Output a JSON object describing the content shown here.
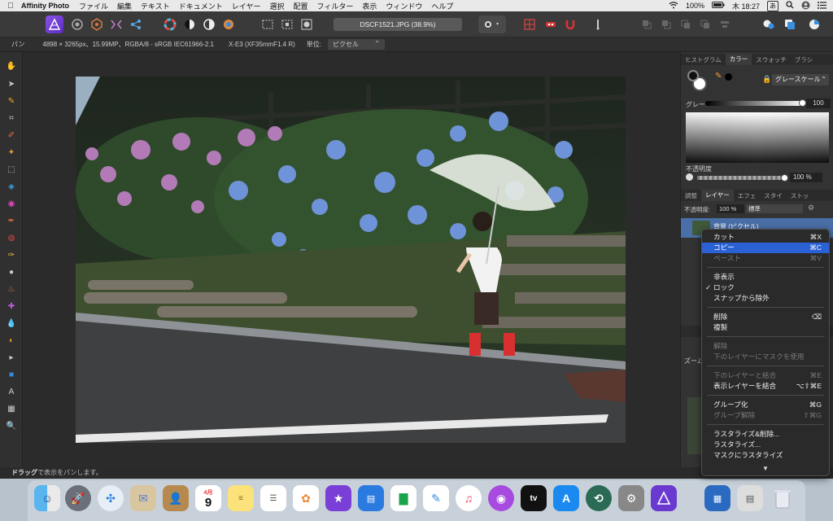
{
  "menubar": {
    "app_name": "Affinity Photo",
    "items": [
      "ファイル",
      "編集",
      "テキスト",
      "ドキュメント",
      "レイヤー",
      "選択",
      "配置",
      "フィルター",
      "表示",
      "ウィンドウ",
      "ヘルプ"
    ],
    "battery": "100%",
    "clock": "木 18:27",
    "input": "あ"
  },
  "toolbar": {
    "document_title": "DSCF1521.JPG (38.9%)"
  },
  "context": {
    "tool": "パン",
    "info": "4898 × 3265px、15.99MP、RGBA/8 - sRGB IEC61966-2.1",
    "camera": "X-E3 (XF35mmF1.4 R)",
    "unit_label": "単位:",
    "unit_value": "ピクセル"
  },
  "panel_top": {
    "tabs": [
      "ヒストグラム",
      "カラー",
      "スウォッチ",
      "ブラシ"
    ],
    "mode": "グレースケール",
    "gray_label": "グレー",
    "gray_value": "100",
    "opacity_label": "不透明度",
    "opacity_value": "100 %"
  },
  "panel_layers": {
    "tabs": [
      "調整",
      "レイヤー",
      "エフェ",
      "スタイ",
      "ストッ"
    ],
    "opacity_label": "不透明度:",
    "opacity_value": "100 %",
    "blend_mode": "標準",
    "layer_name": "背景 (ピクセル)",
    "nav_label": "ズーム"
  },
  "context_menu": {
    "items": [
      {
        "label": "カット",
        "shortcut": "⌘X",
        "state": "normal"
      },
      {
        "label": "コピー",
        "shortcut": "⌘C",
        "state": "highlighted"
      },
      {
        "label": "ペースト",
        "shortcut": "⌘V",
        "state": "disabled"
      },
      {
        "label": "非表示",
        "shortcut": "",
        "state": "normal"
      },
      {
        "label": "ロック",
        "shortcut": "",
        "state": "checked"
      },
      {
        "label": "スナップから除外",
        "shortcut": "",
        "state": "normal"
      },
      {
        "label": "削除",
        "shortcut": "⌫",
        "state": "normal"
      },
      {
        "label": "複製",
        "shortcut": "",
        "state": "normal"
      },
      {
        "label": "解除",
        "shortcut": "",
        "state": "disabled"
      },
      {
        "label": "下のレイヤーにマスクを使用",
        "shortcut": "",
        "state": "disabled"
      },
      {
        "label": "下のレイヤーと結合",
        "shortcut": "⌘E",
        "state": "disabled"
      },
      {
        "label": "表示レイヤーを結合",
        "shortcut": "⌥⇧⌘E",
        "state": "normal"
      },
      {
        "label": "グループ化",
        "shortcut": "⌘G",
        "state": "normal"
      },
      {
        "label": "グループ解除",
        "shortcut": "⇧⌘G",
        "state": "disabled"
      },
      {
        "label": "ラスタライズ&削除...",
        "shortcut": "",
        "state": "normal"
      },
      {
        "label": "ラスタライズ...",
        "shortcut": "",
        "state": "normal"
      },
      {
        "label": "マスクにラスタライズ",
        "shortcut": "",
        "state": "normal"
      }
    ],
    "more_arrow": "▼"
  },
  "statusbar": {
    "bold": "ドラッグ",
    "text": "で表示をパンします。"
  },
  "dock": {
    "calendar_month": "4月",
    "calendar_day": "9",
    "tv_label": "tv"
  }
}
